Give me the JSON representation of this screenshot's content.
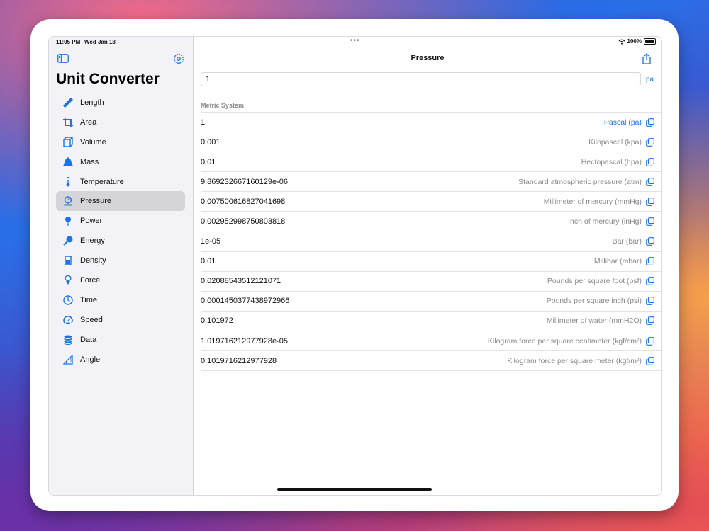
{
  "status_bar": {
    "time": "11:05 PM",
    "date": "Wed Jan 18",
    "battery": "100%"
  },
  "sidebar": {
    "title": "Unit Converter",
    "items": [
      {
        "label": "Length",
        "icon": "ruler-icon"
      },
      {
        "label": "Area",
        "icon": "crop-icon"
      },
      {
        "label": "Volume",
        "icon": "cube-icon"
      },
      {
        "label": "Mass",
        "icon": "scale-icon"
      },
      {
        "label": "Temperature",
        "icon": "thermometer-icon"
      },
      {
        "label": "Pressure",
        "icon": "gauge-icon",
        "active": true
      },
      {
        "label": "Power",
        "icon": "bulb-icon"
      },
      {
        "label": "Energy",
        "icon": "bolt-icon"
      },
      {
        "label": "Density",
        "icon": "beaker-icon"
      },
      {
        "label": "Force",
        "icon": "force-icon"
      },
      {
        "label": "Time",
        "icon": "clock-icon"
      },
      {
        "label": "Speed",
        "icon": "speedometer-icon"
      },
      {
        "label": "Data",
        "icon": "database-icon"
      },
      {
        "label": "Angle",
        "icon": "angle-icon"
      }
    ]
  },
  "detail": {
    "title": "Pressure",
    "input_value": "1",
    "input_unit": "pa",
    "section_header": "Metric System",
    "rows": [
      {
        "value": "1",
        "unit": "Pascal (pa)",
        "primary": true
      },
      {
        "value": "0.001",
        "unit": "Kilopascal (kpa)"
      },
      {
        "value": "0.01",
        "unit": "Hectopascal (hpa)"
      },
      {
        "value": "9.869232667160129e-06",
        "unit": "Standard atmospheric pressure (atm)"
      },
      {
        "value": "0.007500616827041698",
        "unit": "Millimeter of mercury (mmHg)"
      },
      {
        "value": "0.0029529987508038​18",
        "unit": "Inch of mercury (inHg)"
      },
      {
        "value": "1e-05",
        "unit": "Bar (bar)"
      },
      {
        "value": "0.01",
        "unit": "Millibar (mbar)"
      },
      {
        "value": "0.02088543512121071",
        "unit": "Pounds per square foot (psf)"
      },
      {
        "value": "0.0001450377438972966",
        "unit": "Pounds per square inch (psi)"
      },
      {
        "value": "0.101972",
        "unit": "Millimeter of water (mmH2O)"
      },
      {
        "value": "1.019716212977928e-05",
        "unit": "Kilogram force per square centimeter (kgf/cm²)"
      },
      {
        "value": "0.1019716212977928",
        "unit": "Kilogram force per square meter (kgf/m²)"
      }
    ]
  },
  "colors": {
    "accent": "#1a73e8",
    "sidebar_bg": "#f2f2f7",
    "selected_bg": "#d4d4d9"
  }
}
